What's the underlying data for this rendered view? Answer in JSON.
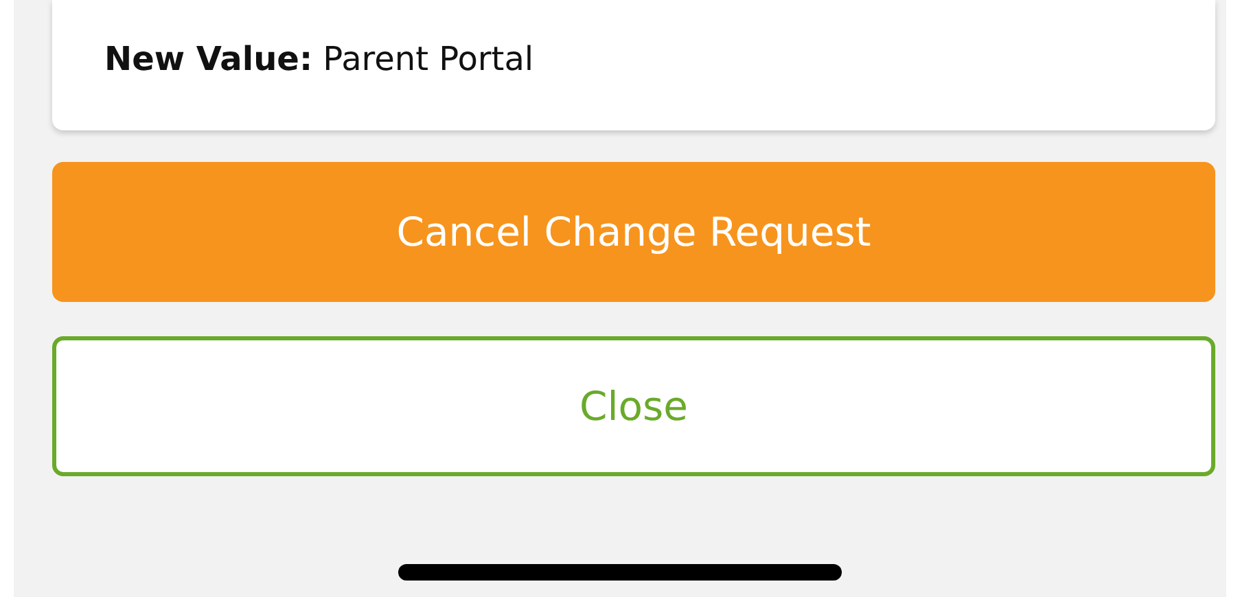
{
  "card": {
    "text": "**New Value:** Parent Portal"
  },
  "buttons": [
    {
      "label": "Cancel Change Request",
      "kind": "primary"
    },
    {
      "label": "Close",
      "kind": "outline"
    }
  ]
}
